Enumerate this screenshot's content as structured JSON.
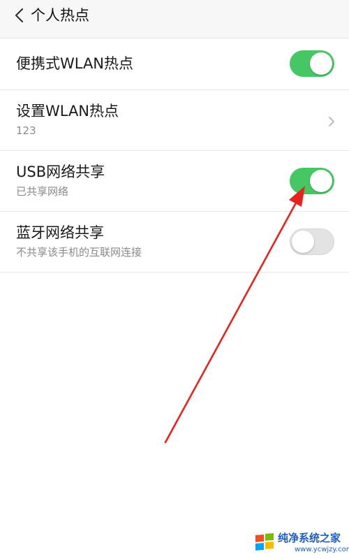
{
  "header": {
    "back_icon": "chevron-left-icon",
    "title": "个人热点"
  },
  "settings": [
    {
      "label": "便携式WLAN热点",
      "subtitle": "",
      "control": "toggle",
      "toggle_on": true
    },
    {
      "label": "设置WLAN热点",
      "subtitle": "123",
      "control": "chevron",
      "chevron_icon": "chevron-right-icon"
    },
    {
      "label": "USB网络共享",
      "subtitle": "已共享网络",
      "control": "toggle",
      "toggle_on": true
    },
    {
      "label": "蓝牙网络共享",
      "subtitle": "不共享该手机的互联网连接",
      "control": "toggle",
      "toggle_on": false
    }
  ],
  "annotation": {
    "type": "red-arrow",
    "points_to": "USB网络共享 toggle",
    "color": "#e8231f"
  },
  "watermark": {
    "title": "纯净系统之家",
    "url": "www.ycwjzy.com"
  },
  "colors": {
    "toggle_on": "#45c764",
    "toggle_off": "#e3e3e3",
    "header_bg": "#f7f7f7",
    "subtitle": "#8a8a8a",
    "watermark": "#1f5fbf"
  }
}
